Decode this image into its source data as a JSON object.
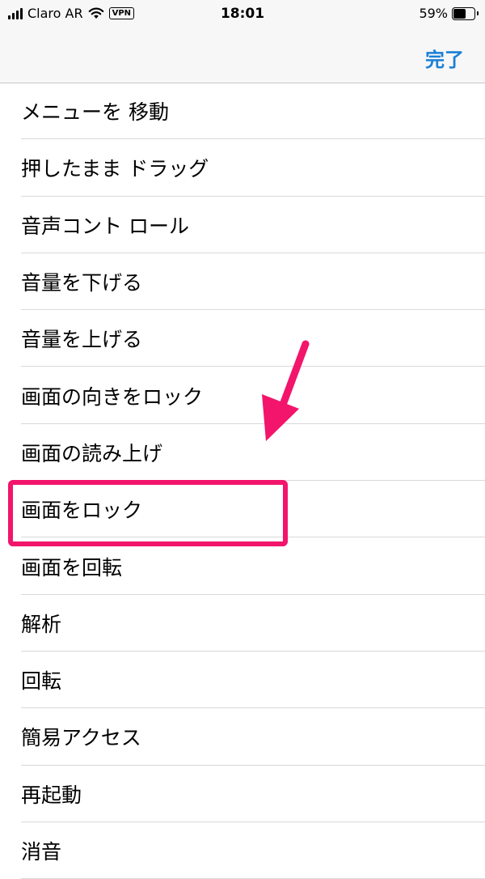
{
  "status_bar": {
    "carrier": "Claro AR",
    "vpn": "VPN",
    "time": "18:01",
    "battery": "59%",
    "battery_level": 0.59
  },
  "nav": {
    "done_label": "完了"
  },
  "menu_items": [
    "メニューを 移動",
    "押したまま ドラッグ",
    "音声コント ロール",
    "音量を下げる",
    "音量を上げる",
    "画面の向きをロック",
    "画面の読み上げ",
    "画面をロック",
    "画面を回転",
    "解析",
    "回転",
    "簡易アクセス",
    "再起動",
    "消音"
  ],
  "colors": {
    "accent": "#1a7fd6",
    "highlight": "#f2156b"
  }
}
